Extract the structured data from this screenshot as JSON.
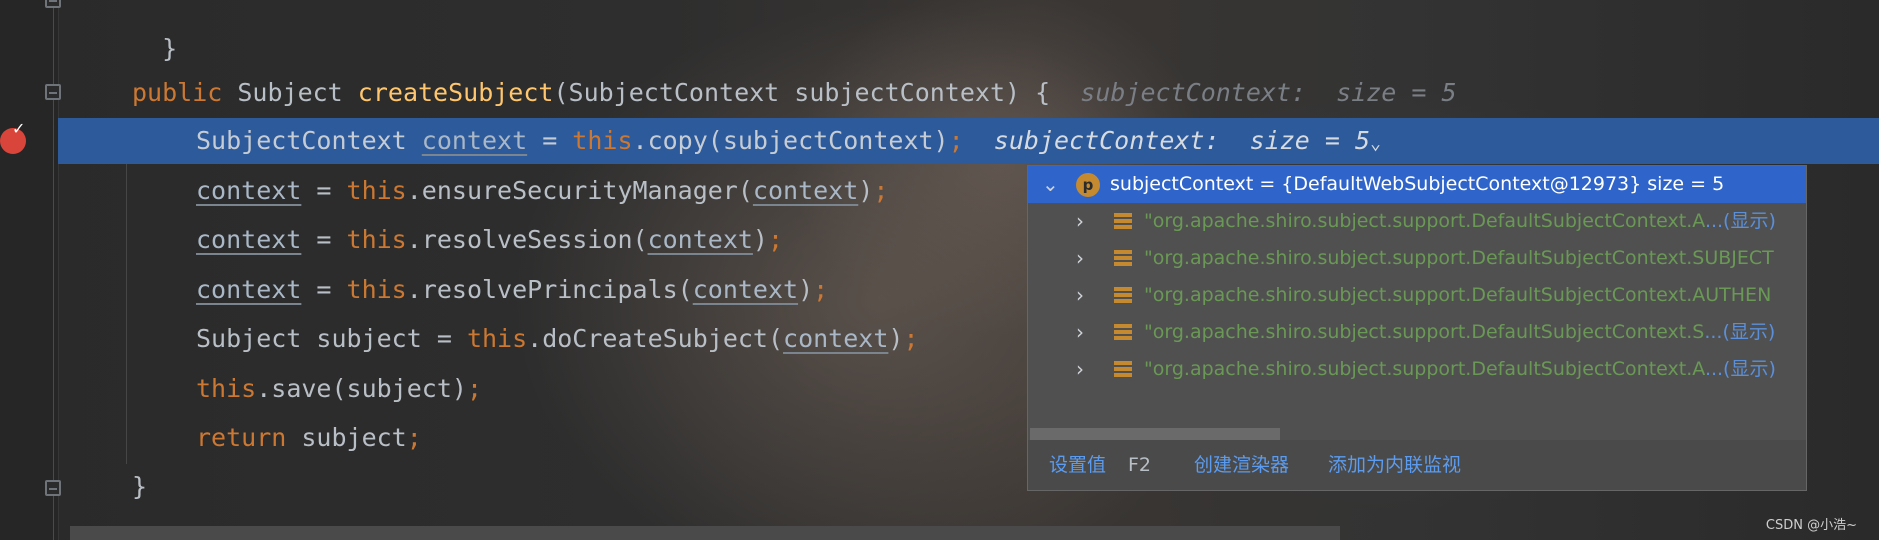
{
  "code": {
    "line_close_prev": "}",
    "sig": {
      "kw_public": "public",
      "type": "Subject",
      "method": "createSubject",
      "params": "(SubjectContext subjectContext) {",
      "hint": "subjectContext:  size = 5"
    },
    "line1": {
      "type": "SubjectContext ",
      "var": "context",
      "eq": " = ",
      "this": "this",
      "call": ".copy(subjectContext)",
      "semi": ";",
      "hint": "subjectContext:  size = 5"
    },
    "line2": {
      "var": "context",
      "eq": " = ",
      "this": "this",
      "call_a": ".ensureSecurityManager(",
      "arg": "context",
      "call_b": ")",
      "semi": ";"
    },
    "line3": {
      "var": "context",
      "eq": " = ",
      "this": "this",
      "call_a": ".resolveSession(",
      "arg": "context",
      "call_b": ")",
      "semi": ";"
    },
    "line4": {
      "var": "context",
      "eq": " = ",
      "this": "this",
      "call_a": ".resolvePrincipals(",
      "arg": "context",
      "call_b": ")",
      "semi": ";"
    },
    "line5": {
      "pre": "Subject subject = ",
      "this": "this",
      "call_a": ".doCreateSubject(",
      "arg": "context",
      "call_b": ")",
      "semi": ";"
    },
    "line6": {
      "this": "this",
      "call": ".save(subject)",
      "semi": ";"
    },
    "line7": {
      "kw": "return",
      "rest": " subject",
      "semi": ";"
    },
    "close": "}"
  },
  "popup": {
    "header_badge": "p",
    "header": "subjectContext = {DefaultWebSubjectContext@12973}  size = 5",
    "rows": [
      {
        "text": "\"org.apache.shiro.subject.support.DefaultSubjectContext.A",
        "more": "...(显示)"
      },
      {
        "text": "\"org.apache.shiro.subject.support.DefaultSubjectContext.SUBJECT",
        "more": ""
      },
      {
        "text": "\"org.apache.shiro.subject.support.DefaultSubjectContext.AUTHEN",
        "more": ""
      },
      {
        "text": "\"org.apache.shiro.subject.support.DefaultSubjectContext.S",
        "more": "...(显示)"
      },
      {
        "text": "\"org.apache.shiro.subject.support.DefaultSubjectContext.A",
        "more": "...(显示)"
      }
    ],
    "footer": {
      "set_value": "设置值",
      "set_value_key": "F2",
      "create_renderer": "创建渲染器",
      "add_inline_watch": "添加为内联监视"
    }
  },
  "watermark": "CSDN @小浩~",
  "colors": {
    "keyword": "#cc7832",
    "method": "#ffc66d",
    "exec_line": "#2d5a9b",
    "string": "#6a9955",
    "link": "#5b9cf0"
  }
}
